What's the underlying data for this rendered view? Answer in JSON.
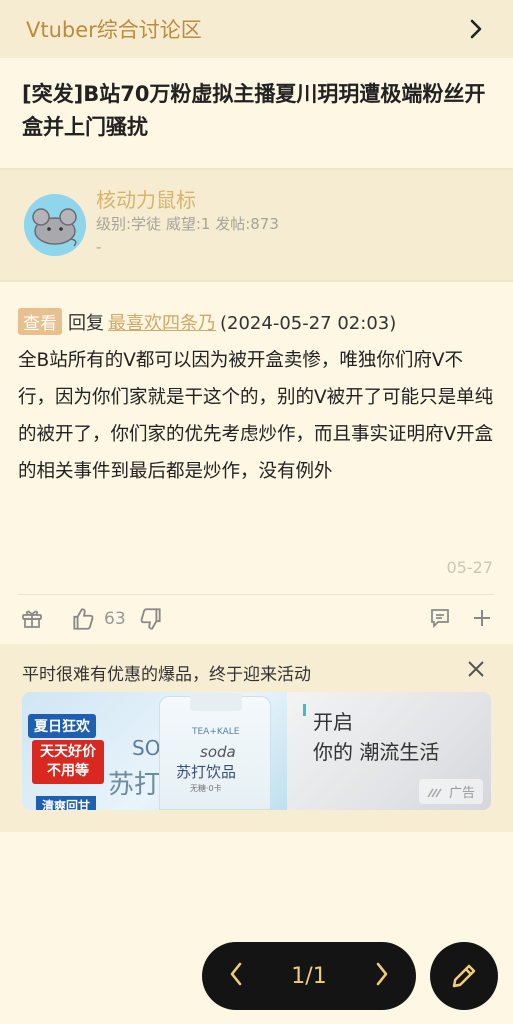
{
  "header": {
    "forum_name": "Vtuber综合讨论区"
  },
  "thread": {
    "title": "[突发]B站70万粉虚拟主播夏川玥玥遭极端粉丝开盒并上门骚扰"
  },
  "author": {
    "name": "核动力鼠标",
    "meta": "级别:学徒 威望:1 发帖:873",
    "signature": "-"
  },
  "post": {
    "badge": "查看",
    "reply_prefix": "回复",
    "reply_user": "最喜欢四条乃",
    "reply_time": "(2024-05-27 02:03)",
    "body": "全B站所有的V都可以因为被开盒卖惨，唯独你们府V不行，因为你们家就是干这个的，别的V被开了可能只是单纯的被开了，你们家的优先考虑炒作，而且事实证明府V开盒的相关事件到最后都是炒作，没有例外",
    "date": "05-27",
    "like_count": "63"
  },
  "ad": {
    "text": "平时很难有优惠的爆品，终于迎来活动",
    "tag1": "夏日狂欢",
    "tag2_line1": "天天好价",
    "tag2_line2": "不用等",
    "tag3": "清爽回甘",
    "bottle_brand": "TEA+KALE",
    "bottle_soda": "soda",
    "bottle_drink": "苏打饮品",
    "bottle_sub": "无糖·0卡",
    "ghost1": "SO",
    "ghost2": "苏打",
    "right_line1": "开启",
    "right_line2": "你的 潮流生活",
    "ad_label": "广告"
  },
  "pager": {
    "page": "1/1"
  },
  "colors": {
    "accent": "#c08a3c",
    "pager_bg": "#141414",
    "pager_text": "#f1cc77"
  }
}
